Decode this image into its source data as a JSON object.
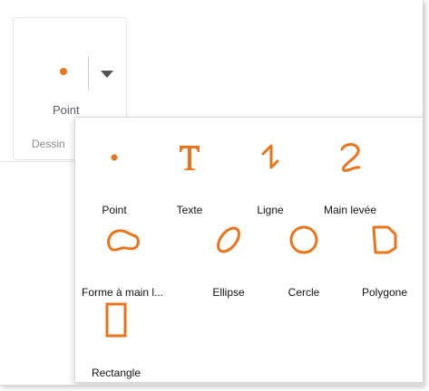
{
  "colors": {
    "accent": "#e9741d",
    "tool_icon": "#e9741d",
    "ribbon_text": "#5c5868"
  },
  "ribbon": {
    "main_button": {
      "label": "Point",
      "icon": "point-icon"
    },
    "dropdown_icon": "chevron-down-icon",
    "group_label": "Dessin"
  },
  "tools": [
    {
      "label": "Point",
      "icon": "point-icon"
    },
    {
      "label": "Texte",
      "icon": "text-icon"
    },
    {
      "label": "Ligne",
      "icon": "line-icon"
    },
    {
      "label": "Main levée",
      "icon": "freehand-icon"
    },
    {
      "label": "Forme à main l...",
      "icon": "freehand-shape-icon"
    },
    {
      "label": "Ellipse",
      "icon": "ellipse-icon"
    },
    {
      "label": "Cercle",
      "icon": "circle-icon"
    },
    {
      "label": "Polygone",
      "icon": "polygon-icon"
    },
    {
      "label": "Rectangle",
      "icon": "rectangle-icon"
    }
  ]
}
